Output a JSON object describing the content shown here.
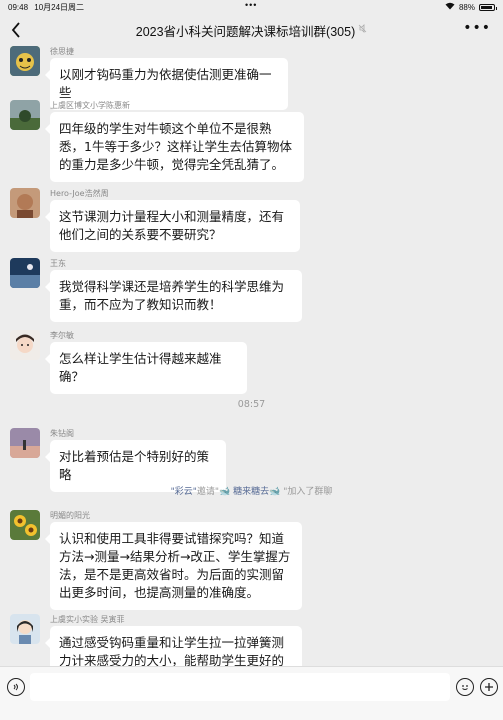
{
  "status_bar": {
    "time": "09:48",
    "date": "10月24日周二",
    "battery": "88%",
    "battery_level": 0.88
  },
  "nav": {
    "title": "2023省小科关问题解决课标培训群(305)",
    "back_icon": "chevron-left-icon",
    "more_icon": "more-icon"
  },
  "messages": [
    {
      "sender": "徐思捷",
      "text": "以刚才钩码重力为依据使估测更准确一些",
      "avatar": "avatar-cartoon"
    },
    {
      "sender": "上虞区博文小学陈惠新",
      "text": "四年级的学生对牛顿这个单位不是很熟悉，1牛等于多少？这样让学生去估算物体的重力是多少牛顿，觉得完全凭乱猜了。",
      "avatar": "avatar-landscape"
    },
    {
      "sender": "Hero-Joe浩然周",
      "text": "这节课测力计量程大小和测量精度，还有他们之间的关系要不要研究？",
      "avatar": "avatar-portrait"
    },
    {
      "sender": "王东",
      "text": "我觉得科学课还是培养学生的科学思维为重，而不应为了教知识而教！",
      "avatar": "avatar-night"
    },
    {
      "sender": "李尔敏",
      "text": "怎么样让学生估计得越来越准确？",
      "avatar": "avatar-child"
    },
    {
      "sender": "朱钻阁",
      "text": "对比着预估是个特别好的策略",
      "avatar": "avatar-sunset"
    },
    {
      "sender": "明媚的阳光",
      "text": "认识和使用工具非得要试错探究吗？知道方法→测量→结果分析→改正、学生掌握方法，是不是更高效省时。为后面的实测留出更多时间，也提高测量的准确度。",
      "avatar": "avatar-sunflower"
    },
    {
      "sender": "上虞实小实验 吴寅菲",
      "text": "通过感受钩码重量和让学生拉一拉弹簧测力计来感受力的大小，能帮助学生更好的进行",
      "avatar": "avatar-cartoon-girl"
    }
  ],
  "time_divider": "08:57",
  "system_message": {
    "actor": "\"彩云\"",
    "verb": "邀请\"",
    "invitee": "糖来糖去",
    "suffix": "\"加入了群聊"
  },
  "input_bar": {
    "voice_icon": "voice-icon",
    "emoji_icon": "emoji-icon",
    "plus_icon": "plus-icon"
  }
}
